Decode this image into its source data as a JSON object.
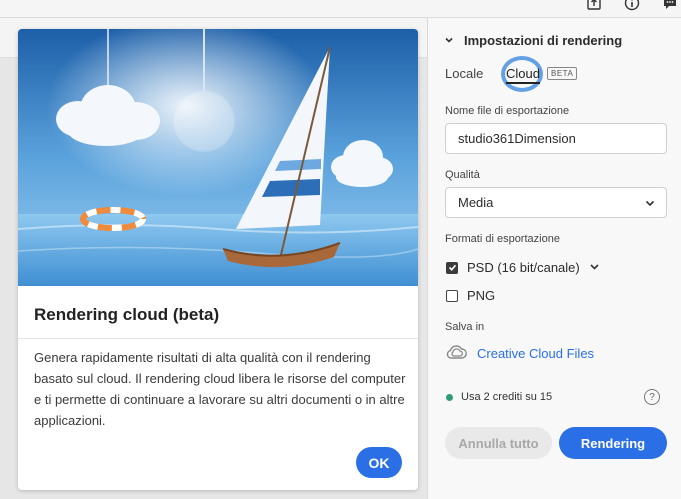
{
  "card": {
    "title": "Rendering cloud (beta)",
    "body": "Genera rapidamente risultati di alta qualità con il rendering basato sul cloud. Il rendering cloud libera le risorse del computer e ti permette di continuare a lavorare su altri documenti o in altre applicazioni.",
    "ok_label": "OK"
  },
  "panel": {
    "header": "Impostazioni di rendering",
    "mode_local": "Locale",
    "mode_cloud": "Cloud",
    "beta_badge": "BETA",
    "filename_label": "Nome file di esportazione",
    "filename_value": "studio361Dimension",
    "quality_label": "Qualità",
    "quality_value": "Media",
    "formats_label": "Formati di esportazione",
    "format_psd": "PSD (16 bit/canale)",
    "format_psd_checked": true,
    "format_png": "PNG",
    "format_png_checked": false,
    "save_label": "Salva in",
    "save_target": "Creative Cloud Files",
    "credits": "Usa 2 crediti su 15",
    "help_glyph": "?",
    "cancel_label": "Annulla tutto",
    "render_label": "Rendering"
  },
  "icons": {
    "top": [
      "share-icon",
      "info-icon",
      "comment-icon"
    ]
  },
  "colors": {
    "accent": "#2a6fe6",
    "status_green": "#2d9d78"
  }
}
